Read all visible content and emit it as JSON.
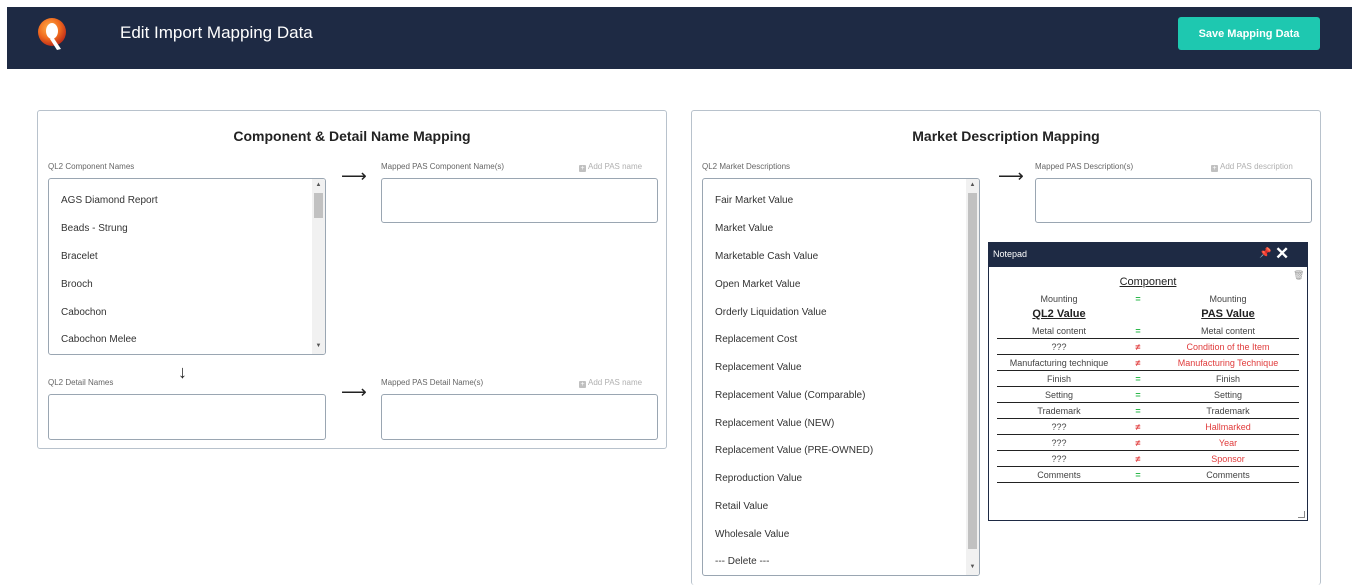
{
  "header": {
    "title": "Edit Import Mapping Data",
    "save_label": "Save Mapping Data",
    "logo_icon": "q-logo-icon",
    "brand_color": "#1e2a44",
    "accent_color": "#1ec8b0"
  },
  "component_panel": {
    "title": "Component & Detail Name Mapping",
    "components_label": "QL2 Component Names",
    "mapped_components_label": "Mapped PAS Component Name(s)",
    "add_pas_name": "Add PAS name",
    "components": [
      "AGS Diamond Report",
      "Beads - Strung",
      "Bracelet",
      "Brooch",
      "Cabochon",
      "Cabochon Melee"
    ],
    "details_label": "QL2 Detail Names",
    "mapped_details_label": "Mapped PAS Detail Name(s)",
    "add_pas_name_detail": "Add PAS name",
    "arrow_right": "⟶",
    "arrow_down": "↓"
  },
  "market_panel": {
    "title": "Market Description Mapping",
    "descriptions_label": "QL2 Market Descriptions",
    "mapped_label": "Mapped PAS Description(s)",
    "add_pas_description": "Add PAS description",
    "descriptions": [
      "Fair Market Value",
      "Market Value",
      "Marketable Cash Value",
      "Open Market Value",
      "Orderly Liquidation Value",
      "Replacement Cost",
      "Replacement Value",
      "Replacement Value (Comparable)",
      "Replacement Value (NEW)",
      "Replacement Value (PRE-OWNED)",
      "Reproduction Value",
      "Retail Value",
      "Wholesale Value",
      "--- Delete ---"
    ]
  },
  "notepad": {
    "title": "Notepad",
    "pin_icon": "pin-icon",
    "close_icon": "close-icon",
    "trash_icon": "trash-icon",
    "heading": "Component",
    "top_row": {
      "left": "Mounting",
      "sym": "=",
      "right": "Mounting"
    },
    "ql2_heading": "QL2 Value",
    "pas_heading": "PAS Value",
    "rows": [
      {
        "left": "Metal content",
        "sym": "=",
        "right": "Metal content",
        "match": true
      },
      {
        "left": "???",
        "sym": "≠",
        "right": "Condition of the Item",
        "match": false
      },
      {
        "left": "Manufacturing technique",
        "sym": "≠",
        "right": "Manufacturing Technique",
        "match": false
      },
      {
        "left": "Finish",
        "sym": "=",
        "right": "Finish",
        "match": true
      },
      {
        "left": "Setting",
        "sym": "=",
        "right": "Setting",
        "match": true
      },
      {
        "left": "Trademark",
        "sym": "=",
        "right": "Trademark",
        "match": true
      },
      {
        "left": "???",
        "sym": "≠",
        "right": "Hallmarked",
        "match": false
      },
      {
        "left": "???",
        "sym": "≠",
        "right": "Year",
        "match": false
      },
      {
        "left": "???",
        "sym": "≠",
        "right": "Sponsor",
        "match": false
      },
      {
        "left": "Comments",
        "sym": "=",
        "right": "Comments",
        "match": true
      }
    ]
  }
}
